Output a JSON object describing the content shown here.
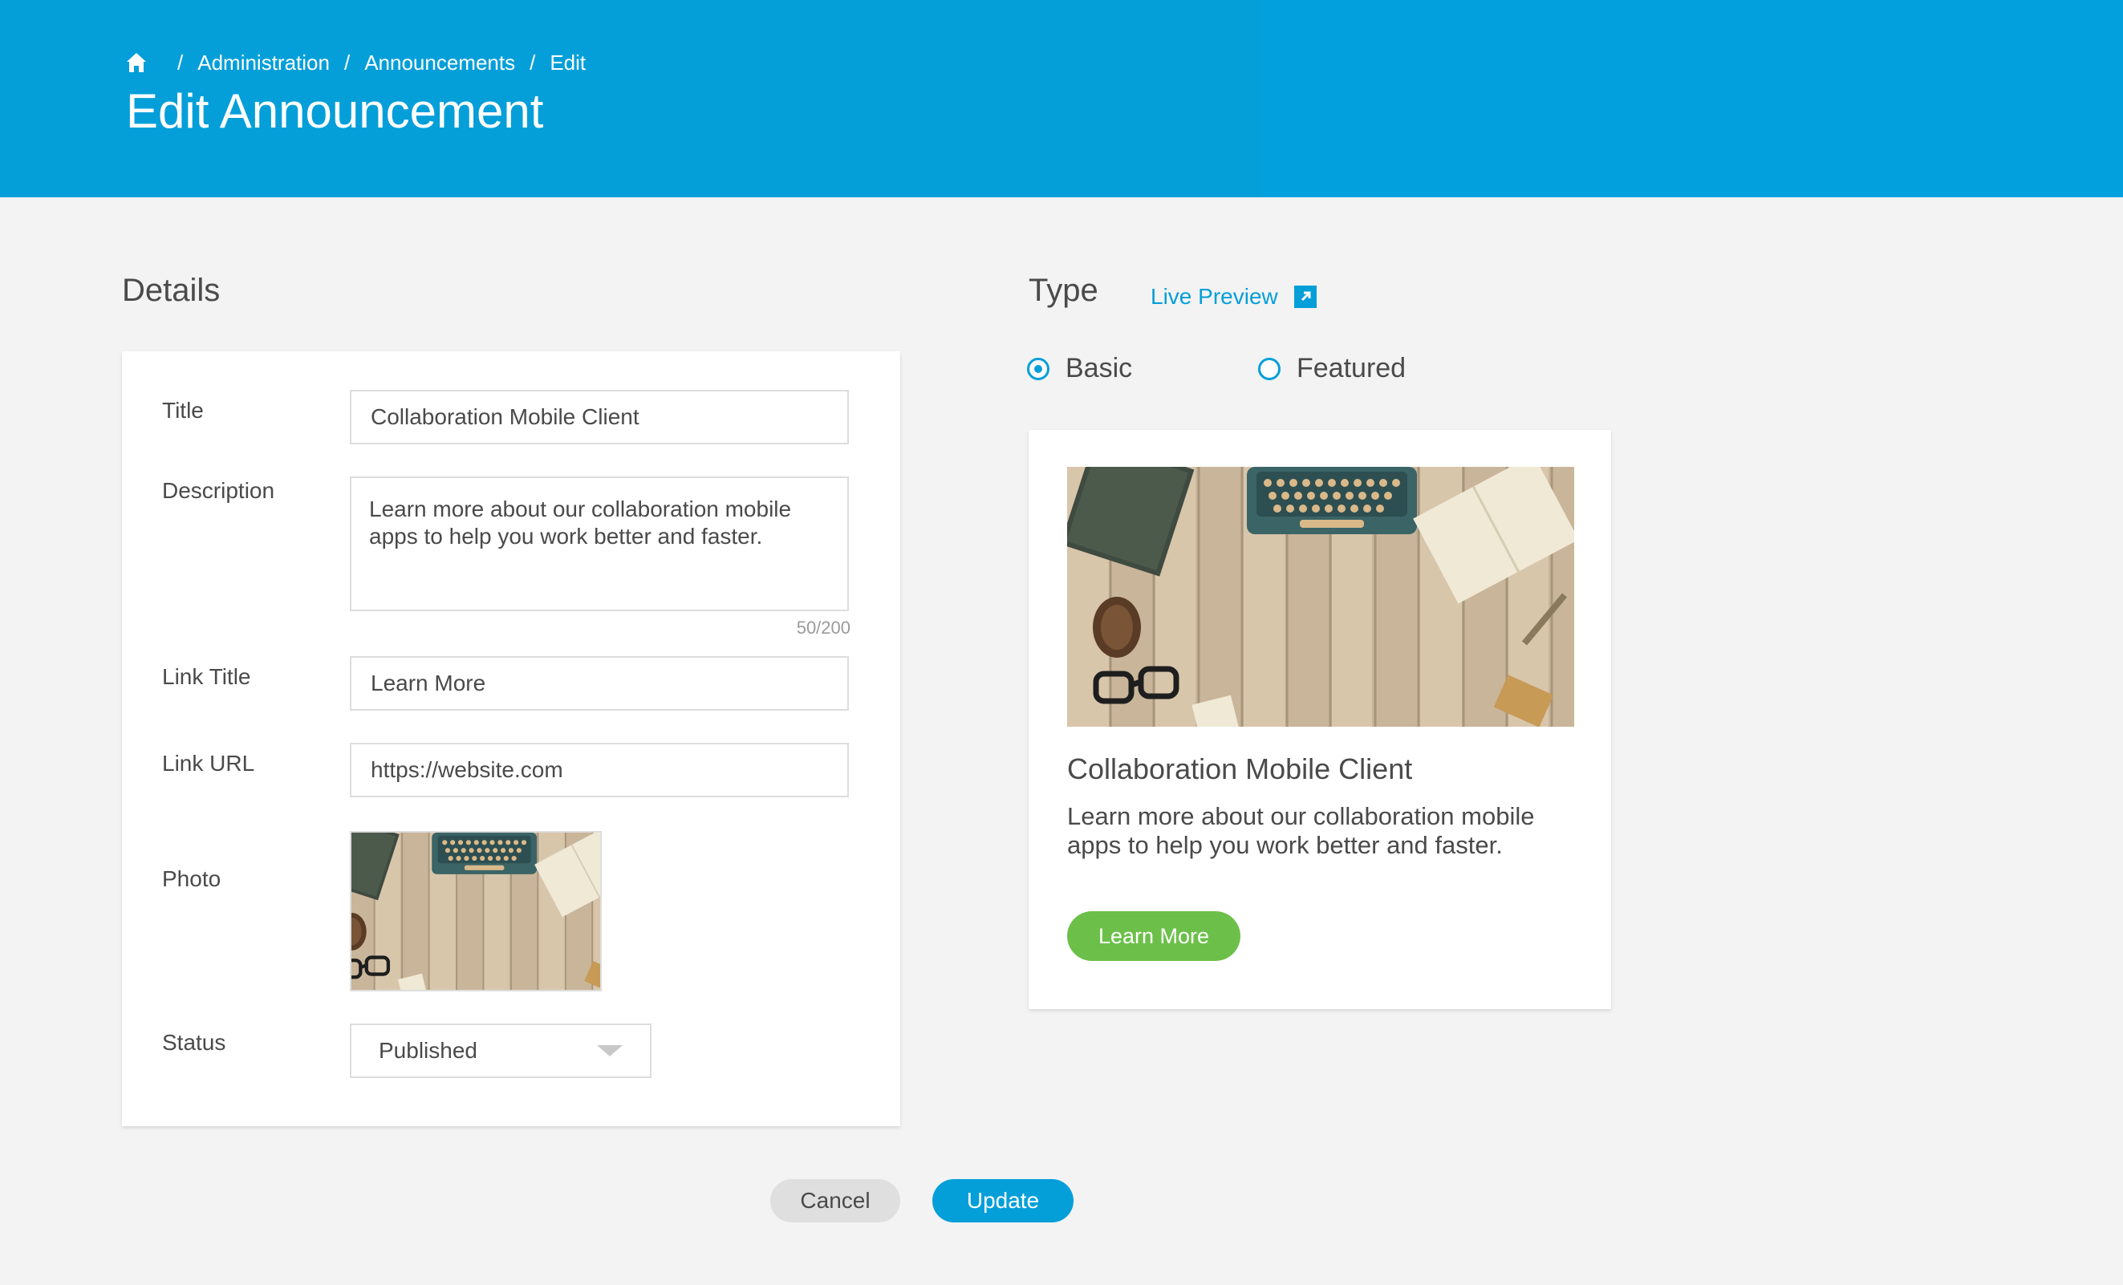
{
  "breadcrumb": {
    "home_icon": "home-icon",
    "separator": "/",
    "items": [
      "Administration",
      "Announcements",
      "Edit"
    ]
  },
  "page": {
    "title": "Edit Announcement"
  },
  "details": {
    "heading": "Details",
    "fields": {
      "title": {
        "label": "Title",
        "value": "Collaboration Mobile Client"
      },
      "description": {
        "label": "Description",
        "value": "Learn more about our collaboration mobile apps to help you work better and faster.",
        "counter": "50/200"
      },
      "link_title": {
        "label": "Link Title",
        "value": "Learn More"
      },
      "link_url": {
        "label": "Link URL",
        "value": "https://website.com"
      },
      "photo": {
        "label": "Photo"
      },
      "status": {
        "label": "Status",
        "value": "Published"
      }
    }
  },
  "type": {
    "heading": "Type",
    "live_preview": "Live Preview",
    "live_preview_icon": "external-link-icon",
    "options": [
      {
        "label": "Basic",
        "checked": true
      },
      {
        "label": "Featured",
        "checked": false
      }
    ]
  },
  "preview": {
    "title": "Collaboration Mobile Client",
    "description": "Learn more about our collaboration mobile apps to help you work better and faster.",
    "button": "Learn More"
  },
  "actions": {
    "cancel": "Cancel",
    "update": "Update"
  },
  "colors": {
    "brand": "#049fd9",
    "success": "#6cc04a",
    "background": "#f3f3f3"
  }
}
